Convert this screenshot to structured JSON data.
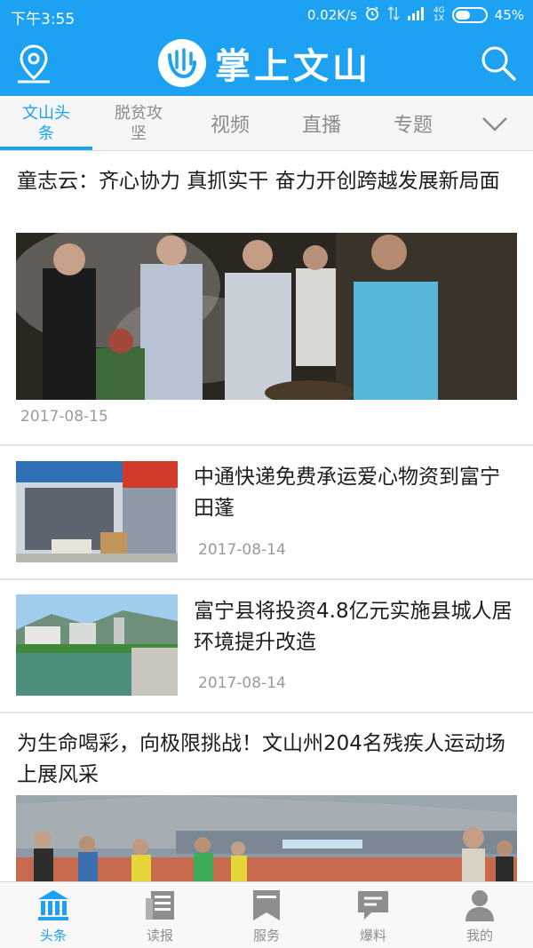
{
  "status_bar": {
    "time": "下午3:55",
    "network_speed": "0.02K/s",
    "network_type_top": "4G",
    "network_type_bottom": "1X",
    "battery": "45%"
  },
  "header": {
    "title": "掌上文山",
    "logo_icon": "wenshan-logo-icon",
    "left_icon": "location-pin-icon",
    "right_icon": "search-icon"
  },
  "tabs": [
    {
      "label": "文山头条",
      "active": true
    },
    {
      "label": "脱贫攻坚",
      "active": false
    },
    {
      "label": "视频",
      "active": false
    },
    {
      "label": "直播",
      "active": false
    },
    {
      "label": "专题",
      "active": false
    }
  ],
  "articles": [
    {
      "title": "童志云：齐心协力 真抓实干 奋力开创跨越发展新局面",
      "date": "2017-08-15",
      "layout": "large-image"
    },
    {
      "title": "中通快递免费承运爱心物资到富宁田蓬",
      "date": "2017-08-14",
      "layout": "thumbnail"
    },
    {
      "title": "富宁县将投资4.8亿元实施县城人居环境提升改造",
      "date": "2017-08-14",
      "layout": "thumbnail"
    },
    {
      "title": "为生命喝彩，向极限挑战！文山州204名残疾人运动场上展风采",
      "layout": "large-image"
    }
  ],
  "bottom_nav": [
    {
      "label": "头条",
      "icon": "bank-icon",
      "active": true
    },
    {
      "label": "读报",
      "icon": "newspaper-icon",
      "active": false
    },
    {
      "label": "服务",
      "icon": "bookmark-icon",
      "active": false
    },
    {
      "label": "爆料",
      "icon": "chat-icon",
      "active": false
    },
    {
      "label": "我的",
      "icon": "person-icon",
      "active": false
    }
  ],
  "colors": {
    "brand_blue": "#1da1f2",
    "inactive_gray": "#8c8c8c",
    "date_gray": "#9a9a9a"
  }
}
